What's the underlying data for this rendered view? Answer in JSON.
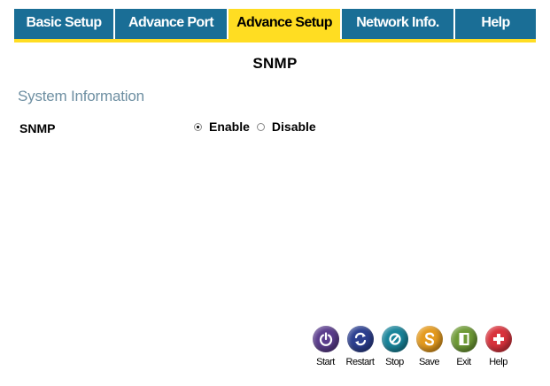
{
  "nav": {
    "tabs": [
      {
        "label": "Basic Setup",
        "active": false
      },
      {
        "label": "Advance Port",
        "active": false
      },
      {
        "label": "Advance Setup",
        "active": true
      },
      {
        "label": "Network Info.",
        "active": false
      },
      {
        "label": "Help",
        "active": false
      }
    ]
  },
  "page": {
    "title": "SNMP"
  },
  "section": {
    "heading": "System Information",
    "snmp_label": "SNMP",
    "options": {
      "enable": "Enable",
      "disable": "Disable",
      "selected": "Enable"
    }
  },
  "toolbar": {
    "buttons": [
      {
        "label": "Start",
        "icon": "power-icon",
        "color": "#5a3c8c"
      },
      {
        "label": "Restart",
        "icon": "restart-icon",
        "color": "#2c3f8f"
      },
      {
        "label": "Stop",
        "icon": "stop-icon",
        "color": "#18849a"
      },
      {
        "label": "Save",
        "icon": "save-icon",
        "color": "#e49a1e"
      },
      {
        "label": "Exit",
        "icon": "exit-icon",
        "color": "#6e9a35"
      },
      {
        "label": "Help",
        "icon": "help-icon",
        "color": "#d8323c"
      }
    ]
  },
  "colors": {
    "tab_blue": "#1a6e96",
    "tab_active_yellow": "#ffdd22",
    "section_heading": "#6e8fa2"
  }
}
